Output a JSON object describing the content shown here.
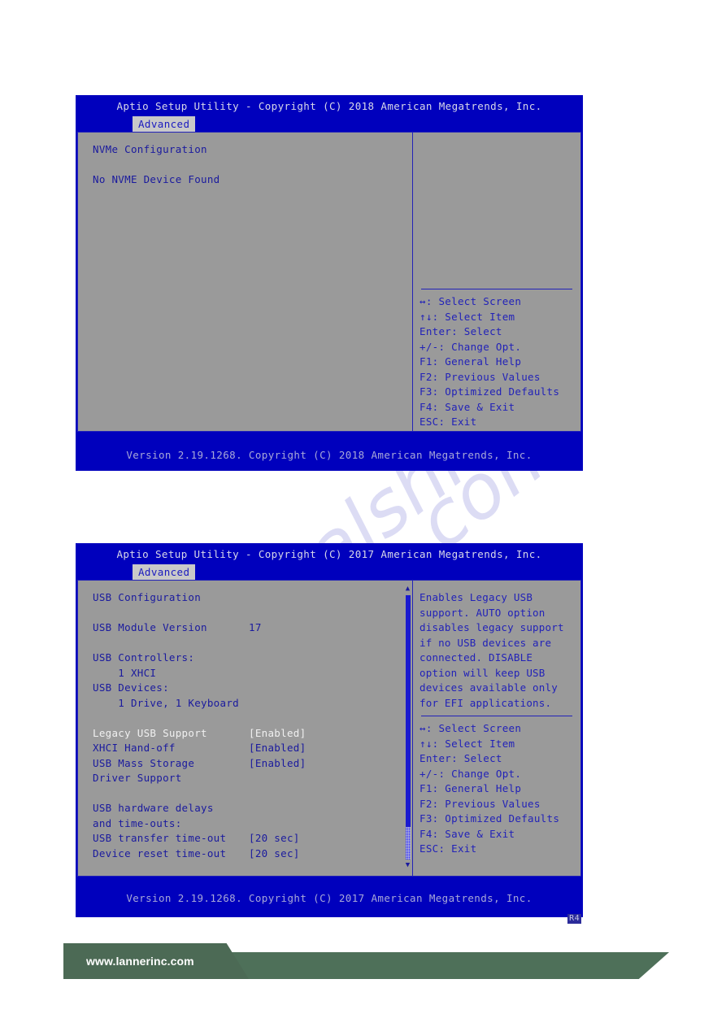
{
  "watermark": {
    "text_1": "manualshive",
    "text_2": ".com"
  },
  "screens": [
    {
      "id": "nvme-configuration",
      "title": "Aptio Setup Utility - Copyright (C) 2018 American Megatrends, Inc.",
      "tab": "Advanced",
      "left_lines": [
        {
          "text": "NVMe Configuration",
          "style": "dark"
        },
        {
          "text": "",
          "style": "blank"
        },
        {
          "text": "No NVME Device Found",
          "style": "dark"
        }
      ],
      "help_text": "",
      "hotkeys": [
        "↔: Select Screen",
        "↑↓: Select Item",
        "Enter: Select",
        "+/-: Change Opt.",
        "F1: General Help",
        "F2: Previous Values",
        "F3: Optimized Defaults",
        "F4: Save & Exit",
        "ESC: Exit"
      ],
      "footer": "Version 2.19.1268. Copyright (C) 2018 American Megatrends, Inc.",
      "scrollbar": false,
      "revision_badge": ""
    },
    {
      "id": "usb-configuration",
      "title": "Aptio Setup Utility - Copyright (C) 2017 American Megatrends, Inc.",
      "tab": "Advanced",
      "left_lines": [
        {
          "text": "USB Configuration",
          "style": "dark"
        },
        {
          "text": "",
          "style": "blank"
        },
        {
          "key": "USB Module Version",
          "value": "17",
          "style": "dark"
        },
        {
          "text": "",
          "style": "blank"
        },
        {
          "text": "USB Controllers:",
          "style": "dark"
        },
        {
          "text": "    1 XHCI",
          "style": "dark"
        },
        {
          "text": "USB Devices:",
          "style": "dark"
        },
        {
          "text": "    1 Drive, 1 Keyboard",
          "style": "dark"
        },
        {
          "text": "",
          "style": "blank"
        },
        {
          "key": "Legacy USB Support",
          "value": "[Enabled]",
          "style": "white"
        },
        {
          "key": "XHCI Hand-off",
          "value": "[Enabled]",
          "style": "dark"
        },
        {
          "key": "USB Mass Storage",
          "value": "[Enabled]",
          "style": "dark"
        },
        {
          "text": "Driver Support",
          "style": "dark"
        },
        {
          "text": "",
          "style": "blank"
        },
        {
          "text": "USB hardware delays",
          "style": "dark"
        },
        {
          "text": "and time-outs:",
          "style": "dark"
        },
        {
          "key": "USB transfer time-out",
          "value": "[20 sec]",
          "style": "dark"
        },
        {
          "key": "Device reset time-out",
          "value": "[20 sec]",
          "style": "dark"
        }
      ],
      "help_text": "Enables Legacy USB support. AUTO option disables legacy support if no USB devices are connected. DISABLE option will keep USB devices available only for EFI applications.",
      "hotkeys": [
        "↔: Select Screen",
        "↑↓: Select Item",
        "Enter: Select",
        "+/-: Change Opt.",
        "F1: General Help",
        "F2: Previous Values",
        "F3: Optimized Defaults",
        "F4: Save & Exit",
        "ESC: Exit"
      ],
      "footer": "Version 2.19.1268. Copyright (C) 2017 American Megatrends, Inc.",
      "scrollbar": true,
      "revision_badge": "R4"
    }
  ],
  "page_footer": {
    "url": "www.lannerinc.com"
  },
  "colors": {
    "bios_blue": "#0000bd",
    "bios_panel_gray": "#9a9a9a",
    "bios_text_blue": "#2222b8",
    "bios_selected_white": "#f0f0f0",
    "banner_green_dark": "#4c6a55",
    "banner_green_light": "#4e7059"
  }
}
